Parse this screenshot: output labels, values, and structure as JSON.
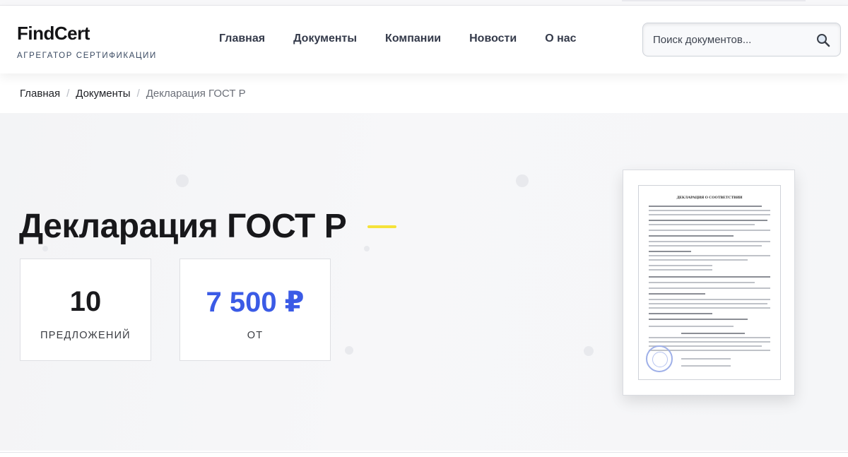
{
  "header": {
    "logo": "FindCert",
    "tagline": "АГРЕГАТОР СЕРТИФИКАЦИИ",
    "nav": [
      "Главная",
      "Документы",
      "Компании",
      "Новости",
      "О нас"
    ],
    "search": {
      "placeholder": "Поиск документов...",
      "icon": "search-icon"
    }
  },
  "breadcrumb": {
    "items": [
      "Главная",
      "Документы"
    ],
    "current": "Декларация ГОСТ Р"
  },
  "hero": {
    "title": "Декларация ГОСТ Р",
    "accent_color": "#f5e23a",
    "stats": [
      {
        "value": "10",
        "label": "ПРЕДЛОЖЕНИЙ"
      },
      {
        "value": "7 500 ₽",
        "label": "ОТ",
        "color": "#3b5be6"
      }
    ]
  },
  "document_preview": {
    "heading": "ДЕКЛАРАЦИЯ О СООТВЕТСТВИИ"
  }
}
